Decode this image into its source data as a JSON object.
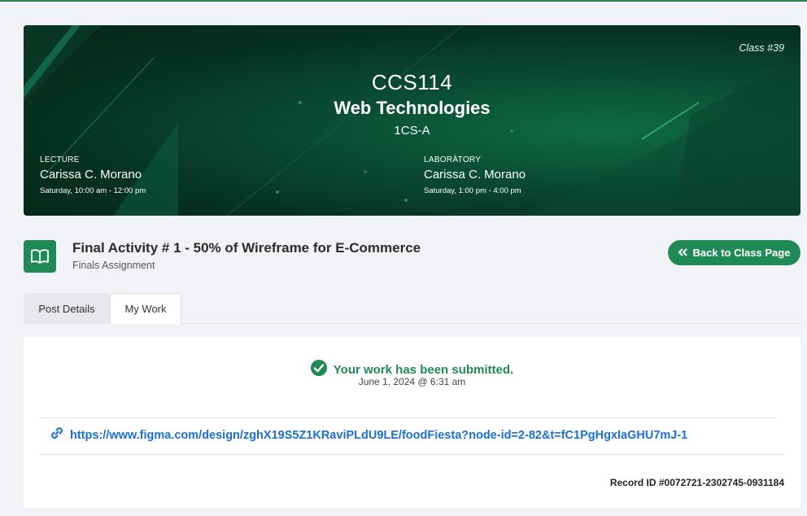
{
  "banner": {
    "class_number": "Class #39",
    "course_code": "CCS114",
    "course_name": "Web Technologies",
    "section": "1CS-A",
    "lecture": {
      "label": "LECTURE",
      "instructor": "Carissa C. Morano",
      "schedule": "Saturday, 10:00 am - 12:00 pm"
    },
    "laboratory": {
      "label": "LABORATORY",
      "instructor": "Carissa C. Morano",
      "schedule": "Saturday, 1:00 pm - 4:00 pm"
    }
  },
  "activity": {
    "icon": "book-open-icon",
    "title": "Final Activity # 1 - 50% of Wireframe for E-Commerce",
    "subtitle": "Finals Assignment",
    "back_button_label": "Back to Class Page",
    "back_button_icon": "double-chevron-left-icon"
  },
  "tabs": [
    {
      "label": "Post Details",
      "active": false
    },
    {
      "label": "My Work",
      "active": true
    }
  ],
  "submission": {
    "status_icon": "check-circle-icon",
    "status_text": "Your work has been submitted.",
    "submitted_at": "June 1, 2024 @ 6:31 am",
    "link_icon": "link-icon",
    "link_url": "https://www.figma.com/design/zghX19S5Z1KRaviPLdU9LE/foodFiesta?node-id=2-82&t=fC1PgHgxIaGHU7mJ-1",
    "record_label": "Record ID",
    "record_id": "#0072721-2302745-0931184"
  },
  "colors": {
    "accent": "#1f8a55",
    "link": "#1a6fd6",
    "banner_dark": "#042617",
    "banner_mid": "#0f6a45"
  }
}
